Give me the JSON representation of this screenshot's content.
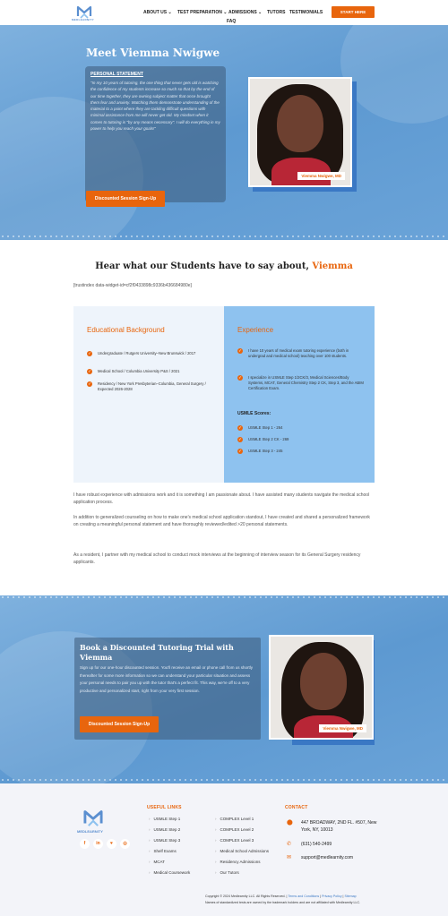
{
  "header": {
    "logo_text": "MEDLEARNITY",
    "nav": [
      "ABOUT US",
      "TEST PREPARATION",
      "ADMISSIONS",
      "TUTORS",
      "TESTIMONIALS",
      "FAQ"
    ],
    "cta": "START HERE"
  },
  "hero": {
    "title": "Meet Viemma Nwigwe",
    "statement_heading": "PERSONAL STATEMENT",
    "statement": "\"In my 10 years of tutoring, the one thing that never gets old is watching the confidence of my students increase so much so that by the end of our time together, they are owning subject matter that once brought them fear and anxiety. Watching them demonstrate understanding of the material to a point where they are tackling difficult questions with minimal assistance from me will never get old. My mindset when it comes to tutoring is \"by any means necessary\". I will do everything in my power to help you reach your goals!\"",
    "cta": "Discounted Session Sign-Up",
    "name_tag": "Viemma Nwigwe, MD"
  },
  "testimonials": {
    "title_prefix": "Hear what our Students have to say about,",
    "title_name": "Viemma",
    "widget": "[trustindex data-widget-id=cf2f0433898c9336b436684980e]"
  },
  "education": {
    "heading": "Educational Background",
    "items": [
      "Undergraduate / Rutgers University–New Brunswick / 2017",
      "Medical School / Columbia University P&S / 2021",
      "Residency / New York Presbyterian–Columbia, General Surgery / Expected 2026-2028"
    ]
  },
  "experience": {
    "heading": "Experience",
    "items": [
      "I have 10 years of medical exam tutoring experience (both in undergrad and medical school) teaching over 100 students.",
      "I specialize in USMLE Step 1/2CK/3, Medical Sciences/Body Systems, MCAT, General Chemistry Step 2 CK, Step 3, and the ABIM Certification Exam."
    ],
    "scores_heading": "USMLE Scores:",
    "scores": [
      "USMLE Step 1 - 264",
      "USMLE Step 2 CK - 269",
      "USMLE Step 3 - 245"
    ]
  },
  "paragraphs": [
    "I have robust experience with admissions work and it is something I am passionate about. I have assisted many students navigate the medical school application process.",
    "In addition to generalized counseling on how to make one's medical school application standout, I have created and shared a personalized framework on creating a meaningful personal statement and have thoroughly reviewed/edited >20 personal statements.",
    "As a resident, I partner with my medical school to conduct mock interviews at the beginning of interview season for its General Surgery residency applicants."
  ],
  "trial": {
    "heading": "Book a Discounted Tutoring Trial with Viemma",
    "body": "Sign up for our one-hour discounted session. You'll receive an email or phone call from us shortly thereafter for some more information so we can understand your particular situation and assess your personal needs to pair you up with the tutor that's a perfect fit. This way, we're off to a very productive and personalized start, right from your very first session.",
    "cta": "Discounted Session Sign-Up",
    "name_tag": "Viemma Nwigwe, MD"
  },
  "footer": {
    "logo_text": "MEDLEARNITY",
    "socials": [
      "f",
      "in",
      "♥",
      "◎"
    ],
    "useful_links_heading": "USEFUL LINKS",
    "links_col1": [
      "USMLE Step 1",
      "USMLE Step 2",
      "USMLE Step 3",
      "Shelf Exams",
      "MCAT",
      "Medical Coursework"
    ],
    "links_col2": [
      "COMPLEX Level 1",
      "COMPLEX Level 2",
      "COMPLEX Level 3",
      "Medical School Admissions",
      "Residency Admissions",
      "Our Tutors"
    ],
    "contact_heading": "CONTACT",
    "address": "447 BROADWAY, 2ND FL. #507, New York, NY, 10013",
    "phone": "(631) 540-2499",
    "email": "support@medlearnity.com",
    "copyright": "Copyright © 2024 Medlearnity LLC. All Rights Reserved.",
    "terms": "Terms and Conditions",
    "privacy": "Privacy Policy",
    "sitemap": "Sitemap",
    "disclaimer": "Names of standardized tests are owned by the trademark holders and are not affiliated with Medlearnity LLC."
  },
  "colors": {
    "accent": "#e8650d",
    "blue": "#8ec2ef",
    "hero": "#6aa3d8"
  }
}
